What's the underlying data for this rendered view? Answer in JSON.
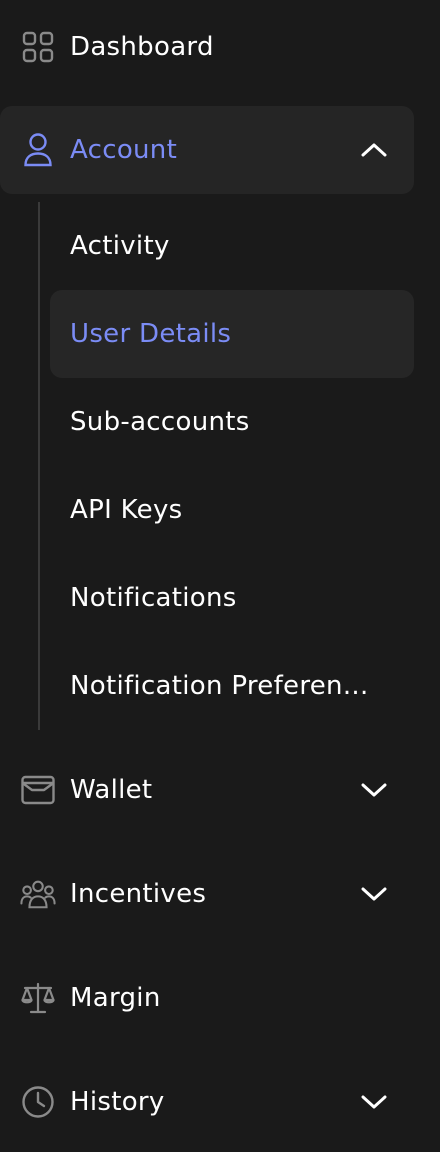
{
  "colors": {
    "background": "#1a1a1a",
    "accent": "#7b8cf5",
    "active_bg": "#252525",
    "icon_gray": "#8a8a8a",
    "text": "#ffffff"
  },
  "nav": {
    "dashboard": {
      "label": "Dashboard",
      "icon": "grid-icon"
    },
    "account": {
      "label": "Account",
      "icon": "user-icon",
      "expanded": true,
      "children": [
        {
          "label": "Activity"
        },
        {
          "label": "User Details",
          "selected": true
        },
        {
          "label": "Sub-accounts"
        },
        {
          "label": "API Keys"
        },
        {
          "label": "Notifications"
        },
        {
          "label": "Notification Preferen..."
        }
      ]
    },
    "wallet": {
      "label": "Wallet",
      "icon": "wallet-icon",
      "expanded": false
    },
    "incentives": {
      "label": "Incentives",
      "icon": "users-group-icon",
      "expanded": false
    },
    "margin": {
      "label": "Margin",
      "icon": "scale-icon"
    },
    "history": {
      "label": "History",
      "icon": "clock-icon",
      "expanded": false
    }
  }
}
